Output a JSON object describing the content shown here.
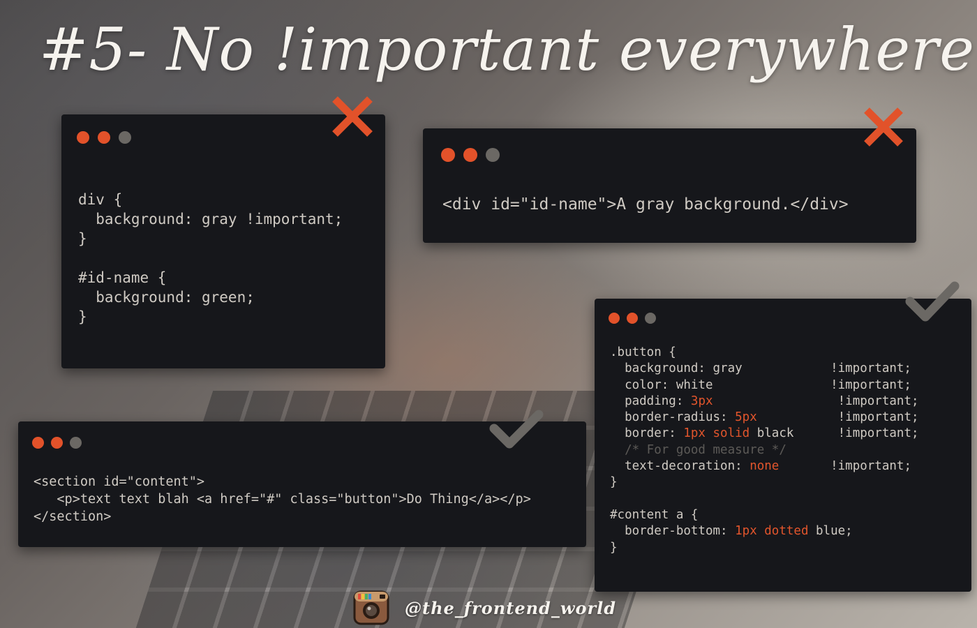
{
  "title": "#5- No !important everywhere",
  "colors": {
    "accent": "#e2522a",
    "window_bg": "#16171b",
    "code_text": "#cfcac3",
    "dot_gray": "#6b6864",
    "check": "#6b6864"
  },
  "icons": {
    "wrong": "cross-icon",
    "right": "check-icon",
    "brand": "instagram-icon"
  },
  "windows": {
    "css_wrong": {
      "lines": [
        "div {",
        "  background: gray !important;",
        "}",
        "",
        "#id-name {",
        "  background: green;",
        "}"
      ]
    },
    "html_wrong": {
      "lines": [
        "<div id=\"id-name\">A gray background.</div>"
      ]
    },
    "css_right": {
      "l1": ".button {",
      "l2a": "  background: gray            ",
      "l2b": "!important;",
      "l3a": "  color: white                ",
      "l3b": "!important;",
      "l4a": "  padding: ",
      "l4v": "3px",
      "l4b": "                 !important;",
      "l5a": "  border-radius: ",
      "l5v": "5px",
      "l5b": "           !important;",
      "l6a": "  border: ",
      "l6v": "1px solid",
      "l6c": " black      ",
      "l6b": "!important;",
      "l7": "  /* For good measure */",
      "l8a": "  text-decoration: ",
      "l8v": "none",
      "l8b": "       !important;",
      "l9": "}",
      "l11": "#content a {",
      "l12a": "  border-bottom: ",
      "l12v": "1px dotted",
      "l12b": " blue;",
      "l13": "}"
    },
    "html_right": {
      "lines": [
        "<section id=\"content\">",
        "   <p>text text blah <a href=\"#\" class=\"button\">Do Thing</a></p>",
        "</section>"
      ]
    }
  },
  "footer": {
    "handle": "@the_frontend_world"
  }
}
